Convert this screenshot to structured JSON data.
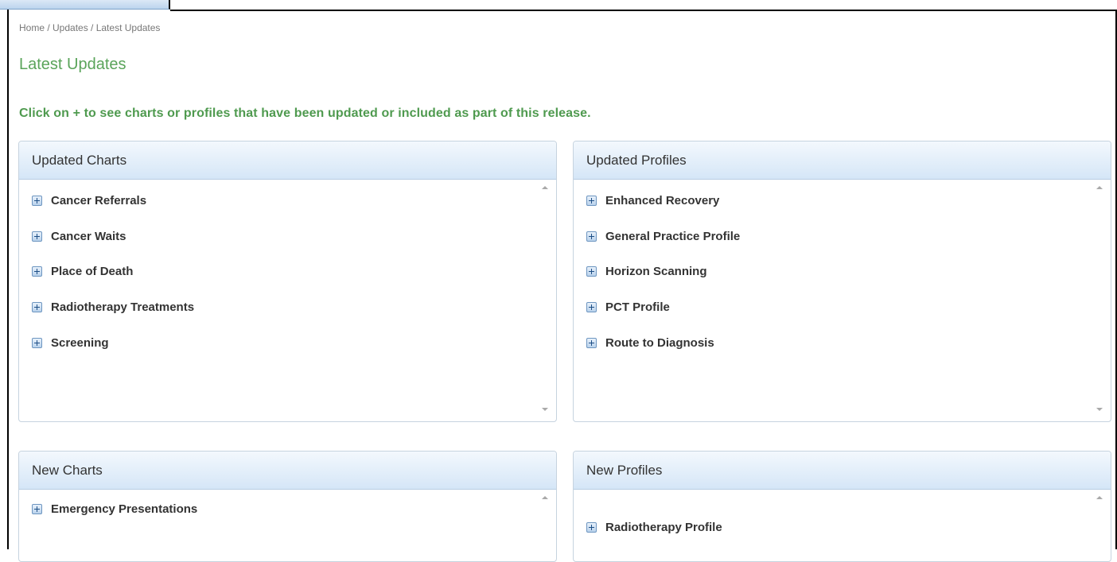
{
  "breadcrumb": "Home / Updates / Latest Updates",
  "page_title": "Latest Updates",
  "instruction": "Click on + to see charts or profiles that have been updated or included as part of this release.",
  "panels": {
    "updated_charts": {
      "title": "Updated Charts",
      "items": [
        "Cancer Referrals",
        "Cancer Waits",
        "Place of Death",
        "Radiotherapy Treatments",
        "Screening"
      ]
    },
    "updated_profiles": {
      "title": "Updated Profiles",
      "items": [
        "Enhanced Recovery",
        "General Practice Profile",
        "Horizon Scanning",
        "PCT Profile",
        "Route to Diagnosis"
      ]
    },
    "new_charts": {
      "title": "New Charts",
      "items": [
        "Emergency Presentations"
      ]
    },
    "new_profiles": {
      "title": "New Profiles",
      "items": [
        "Radiotherapy Profile"
      ]
    }
  },
  "icons": {
    "expand": "plus-expand-icon",
    "scroll_up": "scroll-up-arrow-icon",
    "scroll_down": "scroll-down-arrow-icon"
  },
  "colors": {
    "title_green": "#5aa45a",
    "instruction_green": "#4f9a4f",
    "panel_header_top": "#f3f8fd",
    "panel_header_bottom": "#d5e6f7",
    "panel_border": "#c6d3df"
  }
}
